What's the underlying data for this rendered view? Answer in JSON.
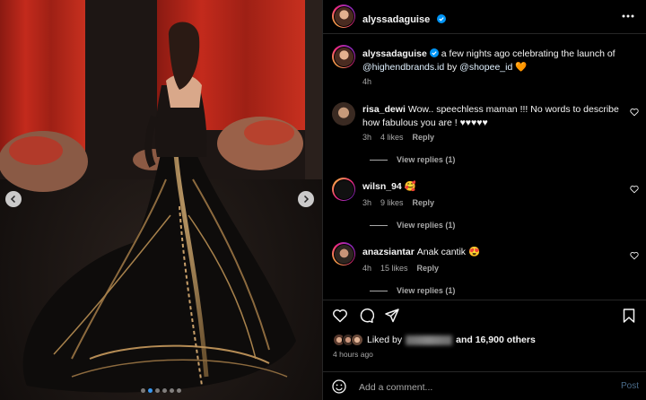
{
  "post": {
    "author": "alyssadaguise",
    "carousel": {
      "slide_count": 6,
      "active_index": 1
    }
  },
  "caption": {
    "username": "alyssadaguise",
    "text_before": "a few nights ago celebrating the launch of",
    "mention1": "@highendbrands.id",
    "text_mid": "by",
    "mention2": "@shopee_id",
    "emoji": "🧡",
    "time": "4h"
  },
  "comments": [
    {
      "username": "risa_dewi",
      "text_line1": "Wow.. speechless maman !!! No words to describe",
      "text_line2": "how fabulous you are ! ♥♥♥♥♥",
      "time": "3h",
      "likes": "4 likes",
      "reply": "Reply",
      "view_replies": "View replies (1)"
    },
    {
      "username": "wilsn_94",
      "text_line1": "🥰",
      "time": "3h",
      "likes": "9 likes",
      "reply": "Reply",
      "view_replies": "View replies (1)"
    },
    {
      "username": "anazsiantar",
      "text_line1": "Anak cantik 😍",
      "time": "4h",
      "likes": "15 likes",
      "reply": "Reply",
      "view_replies": "View replies (1)"
    }
  ],
  "likes": {
    "prefix": "Liked by",
    "suffix": "and 16,900 others"
  },
  "posted_ago": "4 hours ago",
  "comment_box": {
    "placeholder": "Add a comment...",
    "post_label": "Post"
  },
  "icons": {
    "verified": "verified-badge-icon",
    "more": "more-options-icon",
    "like": "heart-icon",
    "comment": "comment-icon",
    "share": "share-icon",
    "save": "bookmark-icon",
    "emoji": "emoji-icon"
  },
  "colors": {
    "verified": "#0095f6",
    "mention": "#e0f1ff",
    "dot_active": "#3897f0"
  }
}
